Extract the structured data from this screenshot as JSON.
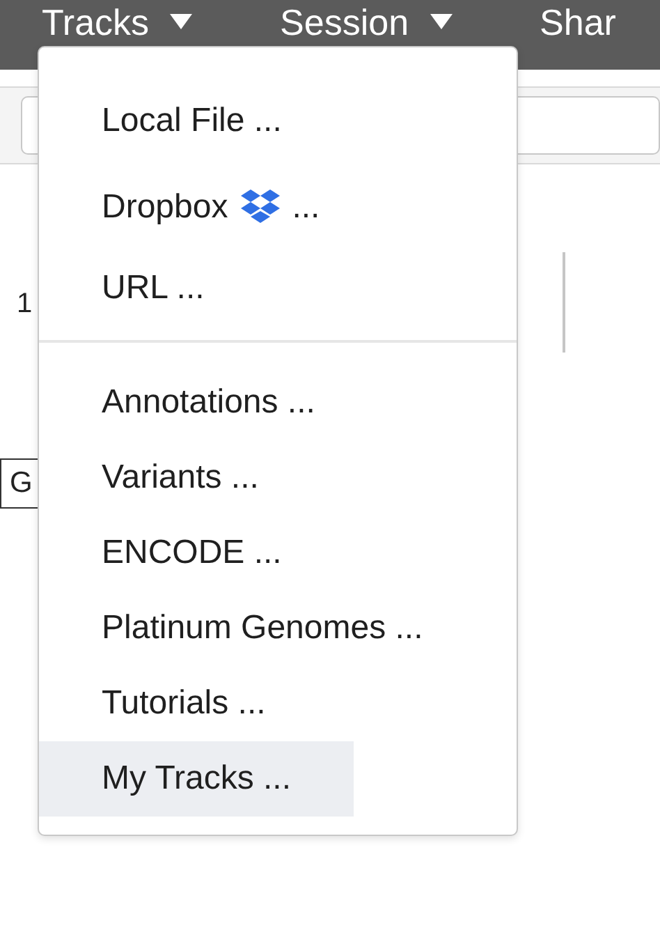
{
  "navbar": [
    {
      "label": "Tracks",
      "caret": true
    },
    {
      "label": "Session",
      "caret": true
    },
    {
      "label": "Shar",
      "caret": false
    }
  ],
  "background": {
    "number_text": "1",
    "go_button": "G"
  },
  "tracks_menu": [
    {
      "kind": "item",
      "label": "Local File ...",
      "highlighted": false
    },
    {
      "kind": "logo-item",
      "label": "Dropbox",
      "after_logo": "...",
      "highlighted": false
    },
    {
      "kind": "item",
      "label": "URL ...",
      "highlighted": false
    },
    {
      "kind": "divider"
    },
    {
      "kind": "item",
      "label": "Annotations ...",
      "highlighted": false
    },
    {
      "kind": "item",
      "label": "Variants ...",
      "highlighted": false
    },
    {
      "kind": "item",
      "label": "ENCODE ...",
      "highlighted": false
    },
    {
      "kind": "item",
      "label": "Platinum Genomes ...",
      "highlighted": false
    },
    {
      "kind": "item",
      "label": "Tutorials ...",
      "highlighted": false
    },
    {
      "kind": "item",
      "label": "My Tracks ...",
      "highlighted": true
    }
  ]
}
